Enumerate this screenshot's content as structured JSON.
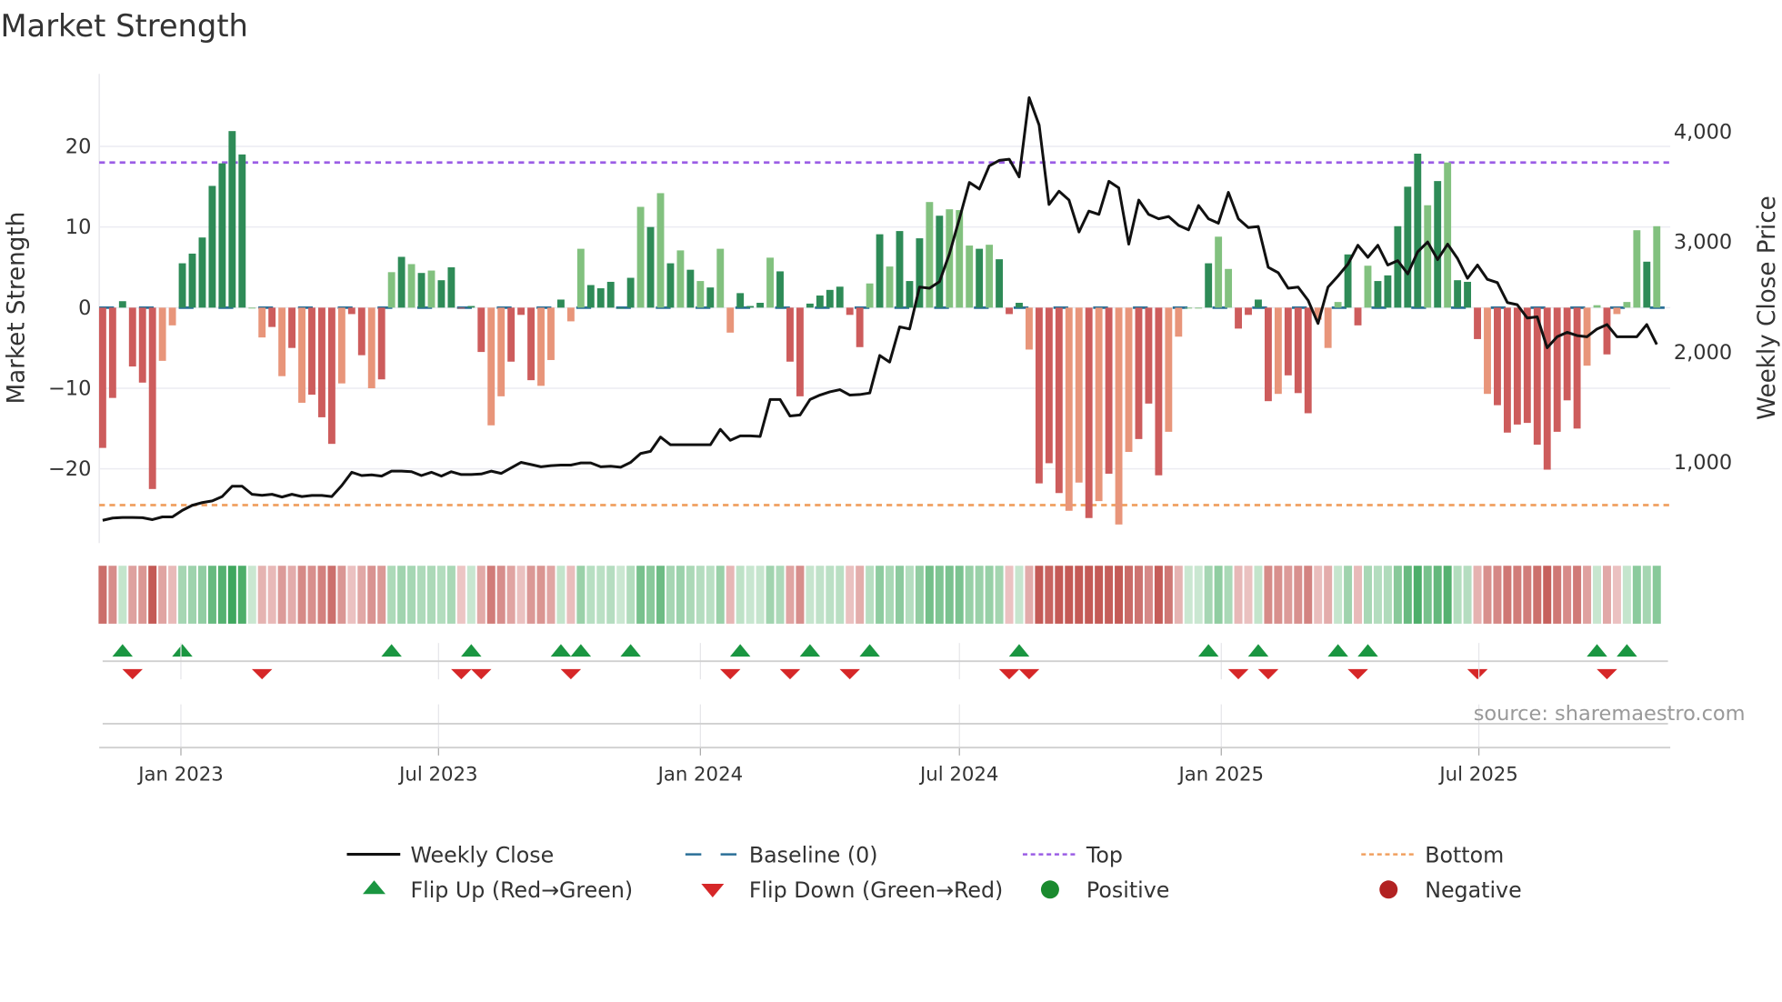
{
  "chart_data": {
    "type": "bar",
    "title": "Market Strength",
    "ylabel": "Market Strength",
    "y2label": "Weekly Close Price",
    "ylim": [
      -29.2,
      29
    ],
    "y2lim": [
      258,
      4515
    ],
    "yticks": [
      20,
      10,
      0,
      -10,
      -20
    ],
    "ytick_labels": [
      "20",
      "10",
      "0",
      "−10",
      "−20"
    ],
    "y2ticks": [
      4000,
      3000,
      2000,
      1000
    ],
    "y2tick_labels": [
      "4,000",
      "3,000",
      "2,000",
      "1,000"
    ],
    "x_start_date": "2022-11-07",
    "x_frequency": "weekly",
    "xticks": [
      {
        "date": "2023-01-01",
        "label": "Jan 2023"
      },
      {
        "date": "2023-07-01",
        "label": "Jul 2023"
      },
      {
        "date": "2024-01-01",
        "label": "Jan 2024"
      },
      {
        "date": "2024-07-01",
        "label": "Jul 2024"
      },
      {
        "date": "2025-01-01",
        "label": "Jan 2025"
      },
      {
        "date": "2025-07-01",
        "label": "Jul 2025"
      }
    ],
    "top_level": 18.0,
    "bottom_level": -24.5,
    "baseline": 0,
    "strength": [
      -17.4,
      -11.2,
      0.8,
      -7.3,
      -9.3,
      -22.5,
      -6.6,
      -2.2,
      5.5,
      6.7,
      8.7,
      15.1,
      17.9,
      21.9,
      19.0,
      0,
      -3.7,
      -2.4,
      -8.5,
      -5.0,
      -11.8,
      -10.8,
      -13.6,
      -16.9,
      -9.4,
      -0.8,
      -5.9,
      -10.0,
      -8.9,
      4.4,
      6.3,
      5.4,
      4.3,
      4.6,
      3.4,
      5.0,
      -0.1,
      0.2,
      -5.5,
      -14.6,
      -11.0,
      -6.7,
      -0.9,
      -9.0,
      -9.7,
      -6.5,
      1.0,
      -1.7,
      7.3,
      2.8,
      2.4,
      3.2,
      0,
      3.7,
      12.5,
      10.0,
      14.2,
      5.5,
      7.1,
      4.7,
      3.3,
      2.5,
      7.3,
      -3.1,
      1.8,
      0.2,
      0.6,
      6.2,
      4.5,
      -6.7,
      -11.0,
      0.5,
      1.5,
      2.2,
      2.6,
      -0.9,
      -4.9,
      3.0,
      9.1,
      5.1,
      9.5,
      3.3,
      8.6,
      13.1,
      11.4,
      12.2,
      12.1,
      7.7,
      7.3,
      7.8,
      6.0,
      -0.8,
      0.6,
      -5.2,
      -21.8,
      -19.3,
      -23.0,
      -25.2,
      -21.7,
      -26.1,
      -24.0,
      -20.6,
      -26.9,
      -17.9,
      -16.3,
      -11.9,
      -20.8,
      -15.4,
      -3.6,
      0,
      0,
      5.5,
      8.8,
      4.8,
      -2.6,
      -0.9,
      1.0,
      -11.6,
      -10.7,
      -8.4,
      -10.6,
      -13.1,
      -1.5,
      -5.0,
      0.7,
      6.6,
      -2.2,
      5.2,
      3.3,
      4.0,
      10.1,
      15.0,
      19.1,
      12.7,
      15.7,
      18.0,
      3.4,
      3.2,
      -3.9,
      -10.7,
      -12.1,
      -15.5,
      -14.5,
      -14.3,
      -17.0,
      -20.1,
      -15.4,
      -11.5,
      -15.0,
      -7.2,
      0.3,
      -5.8,
      -0.8,
      0.7,
      9.6,
      5.7,
      10.1
    ],
    "shade": "ddddddlldddddddlldldldddlddldldldldddddlldddlldlldddddldldldldlldddldddddddddldldddldllldldddldddlldldlldddlllldllddddldddlllddldddddldldddldddddddddlldllldldldddldld",
    "weekly_close": [
      464,
      485,
      490,
      490,
      488,
      470,
      495,
      495,
      555,
      600,
      625,
      640,
      680,
      773,
      773,
      700,
      691,
      700,
      675,
      700,
      680,
      690,
      690,
      680,
      780,
      900,
      870,
      876,
      865,
      910,
      910,
      905,
      870,
      900,
      865,
      905,
      880,
      880,
      885,
      910,
      890,
      940,
      990,
      970,
      950,
      960,
      965,
      965,
      985,
      985,
      950,
      955,
      945,
      990,
      1070,
      1090,
      1220,
      1150,
      1150,
      1150,
      1150,
      1150,
      1290,
      1190,
      1230,
      1230,
      1225,
      1560,
      1560,
      1410,
      1420,
      1560,
      1600,
      1630,
      1650,
      1600,
      1605,
      1620,
      1960,
      1900,
      2220,
      2200,
      2580,
      2570,
      2630,
      2880,
      3200,
      3530,
      3470,
      3680,
      3730,
      3740,
      3580,
      4300,
      4050,
      3330,
      3450,
      3370,
      3080,
      3270,
      3240,
      3540,
      3480,
      2970,
      3370,
      3240,
      3200,
      3220,
      3140,
      3100,
      3320,
      3200,
      3160,
      3440,
      3200,
      3120,
      3130,
      2760,
      2710,
      2570,
      2580,
      2460,
      2250,
      2580,
      2680,
      2790,
      2960,
      2850,
      2960,
      2780,
      2820,
      2700,
      2900,
      2990,
      2830,
      2970,
      2840,
      2660,
      2780,
      2650,
      2620,
      2440,
      2420,
      2300,
      2310,
      2030,
      2130,
      2170,
      2140,
      2130,
      2200,
      2240,
      2130,
      2130,
      2130,
      2240,
      2060
    ],
    "legend": [
      {
        "label": "Weekly Close",
        "kind": "line"
      },
      {
        "label": "Baseline (0)",
        "kind": "dash"
      },
      {
        "label": "Top",
        "kind": "dot-purple"
      },
      {
        "label": "Bottom",
        "kind": "dot-orange"
      },
      {
        "label": "Flip Up (Red→Green)",
        "kind": "tri-up"
      },
      {
        "label": "Flip Down (Green→Red)",
        "kind": "tri-down"
      },
      {
        "label": "Positive",
        "kind": "circle-green"
      },
      {
        "label": "Negative",
        "kind": "circle-red"
      }
    ],
    "legend_placement": "bottom",
    "source": "source: sharemaestro.com",
    "colors": {
      "pos_dark": "#2e8b57",
      "pos_light": "#82c17f",
      "neg_dark": "#cd5c5c",
      "neg_light": "#e8957a",
      "top": "#9b5de5",
      "bottom": "#f0a060",
      "baseline": "#2a6f97",
      "line": "#111111",
      "flip_up": "#1a9641",
      "flip_down": "#d62728",
      "legend_pos": "#1a8a2e",
      "legend_neg": "#b22222"
    }
  }
}
